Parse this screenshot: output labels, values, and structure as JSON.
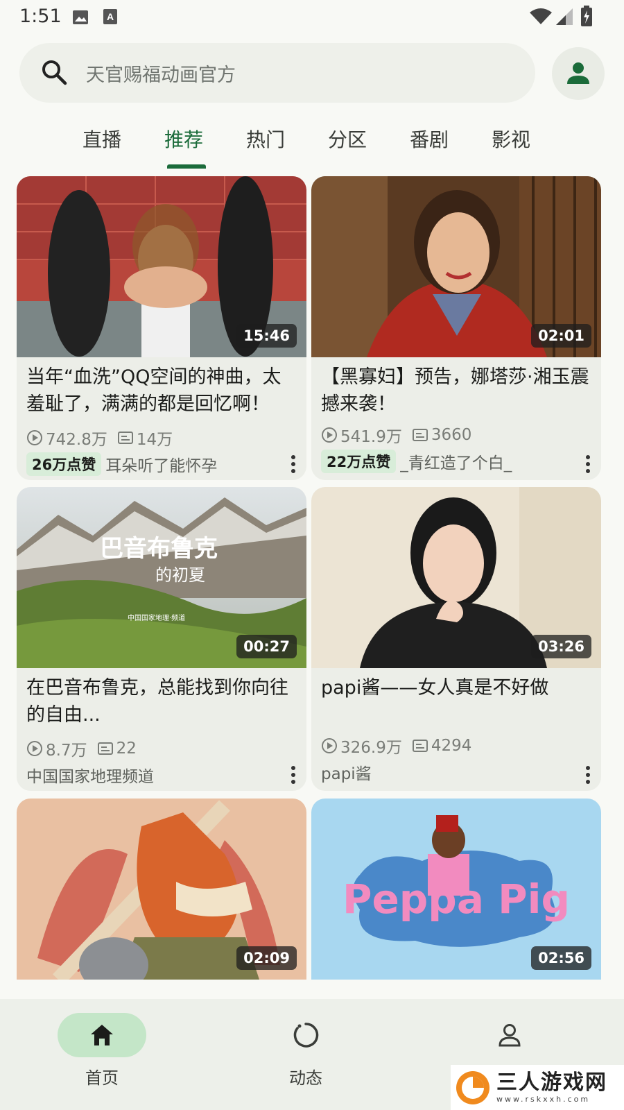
{
  "status_bar": {
    "time": "1:51"
  },
  "search": {
    "placeholder": "天官赐福动画官方"
  },
  "tabs": [
    {
      "label": "直播"
    },
    {
      "label": "推荐",
      "active": true
    },
    {
      "label": "热门"
    },
    {
      "label": "分区"
    },
    {
      "label": "番剧"
    },
    {
      "label": "影视"
    }
  ],
  "cards": [
    {
      "title": "当年“血洗”QQ空间的神曲，太羞耻了，满满的都是回忆啊！",
      "duration": "15:46",
      "views": "742.8万",
      "danmaku": "14万",
      "likes": "26万点赞",
      "author": "耳朵听了能怀孕"
    },
    {
      "title": "【黑寡妇】预告，娜塔莎·湘玉震撼来袭！",
      "duration": "02:01",
      "views": "541.9万",
      "danmaku": "3660",
      "likes": "22万点赞",
      "author": "_青红造了个白_"
    },
    {
      "title": "在巴音布鲁克，总能找到你向往的自由...",
      "duration": "00:27",
      "views": "8.7万",
      "danmaku": "22",
      "author": "中国国家地理频道",
      "thumb_text": "巴音布鲁克",
      "thumb_text2": "的初夏",
      "thumb_logo": "中国国家地理·频道"
    },
    {
      "title": "papi酱——女人真是不好做",
      "duration": "03:26",
      "views": "326.9万",
      "danmaku": "4294",
      "author": "papi酱"
    },
    {
      "duration": "02:09"
    },
    {
      "duration": "02:56",
      "thumb_text": "Peppa Pig"
    }
  ],
  "bottom_nav": [
    {
      "label": "首页",
      "icon": "home-icon",
      "active": true
    },
    {
      "label": "动态",
      "icon": "dynamic-icon"
    },
    {
      "label": "",
      "icon": "profile-icon"
    }
  ],
  "watermark": {
    "main": "三人游戏网",
    "sub": "www.rskxxh.com"
  },
  "colors": {
    "accent": "#1b6b3a",
    "nav_active_bg": "#c4e6c8",
    "like_badge_bg": "#d8edd9"
  }
}
